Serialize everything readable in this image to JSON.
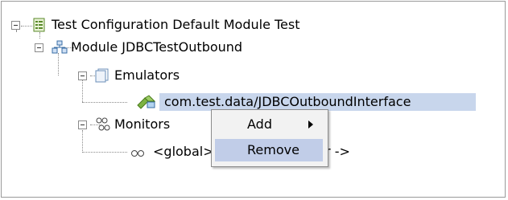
{
  "tree": {
    "root": {
      "label": "Test Configuration Default Module Test",
      "icon": "test-configuration-icon"
    },
    "module": {
      "label": "Module JDBCTestOutbound",
      "icon": "module-icon"
    },
    "emulators": {
      "label": "Emulators",
      "icon": "emulators-folder-icon"
    },
    "emulator_item": {
      "label": "com.test.data/JDBCOutboundInterface",
      "icon": "emulator-icon"
    },
    "monitors": {
      "label": "Monitors",
      "icon": "monitors-icon"
    },
    "monitor_item": {
      "label": "<global>  dInterfacePartner ->",
      "icon": "monitor-icon"
    }
  },
  "context_menu": {
    "items": [
      {
        "label": "Add",
        "has_submenu": true
      },
      {
        "label": "Remove",
        "has_submenu": false
      }
    ]
  },
  "colors": {
    "selection": "#c8d6ec",
    "menu_hover": "#c1cde8",
    "menu_bg": "#f2f2f2"
  }
}
